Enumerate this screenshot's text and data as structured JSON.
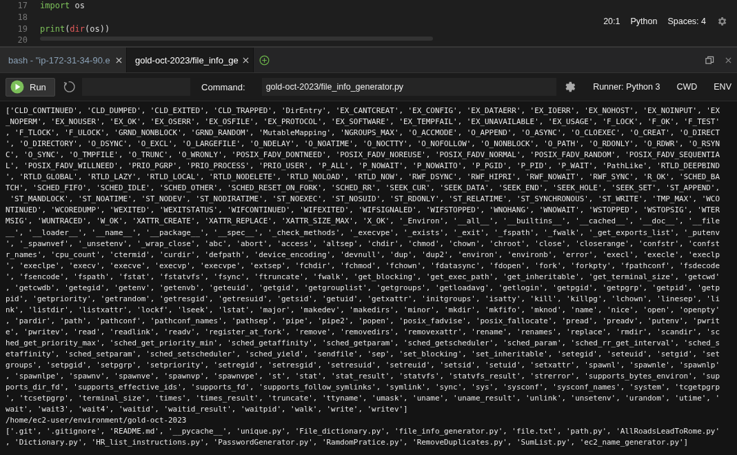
{
  "editor": {
    "lines": [
      {
        "number": "17",
        "tokens": [
          {
            "kind": "keyword",
            "text": "import"
          },
          {
            "kind": "plain",
            "text": " os"
          }
        ]
      },
      {
        "number": "18"
      },
      {
        "number": "19",
        "tokens": [
          {
            "kind": "function",
            "text": "print"
          },
          {
            "kind": "plain",
            "text": "("
          },
          {
            "kind": "builtin",
            "text": "dir"
          },
          {
            "kind": "plain",
            "text": "(os))"
          }
        ]
      },
      {
        "number": "20"
      }
    ],
    "status": {
      "position": "20:1",
      "language": "Python",
      "indent": "Spaces: 4"
    }
  },
  "tabs": [
    {
      "label": "bash - \"ip-172-31-34-90.e",
      "selected": false
    },
    {
      "label": "gold-oct-2023/file_info_ge",
      "selected": true
    }
  ],
  "toolbar": {
    "run": "Run",
    "command_label": "Command:",
    "command": "gold-oct-2023/file_info_generator.py",
    "runner": "Runner: Python 3",
    "cwd": "CWD",
    "env": "ENV"
  },
  "output": [
    "['CLD_CONTINUED', 'CLD_DUMPED', 'CLD_EXITED', 'CLD_TRAPPED', 'DirEntry', 'EX_CANTCREAT', 'EX_CONFIG', 'EX_DATAERR', 'EX_IOERR', 'EX_NOHOST', 'EX_NOINPUT', 'EX",
    "_NOPERM', 'EX_NOUSER', 'EX_OK', 'EX_OSERR', 'EX_OSFILE', 'EX_PROTOCOL', 'EX_SOFTWARE', 'EX_TEMPFAIL', 'EX_UNAVAILABLE', 'EX_USAGE', 'F_LOCK', 'F_OK', 'F_TEST'",
    ", 'F_TLOCK', 'F_ULOCK', 'GRND_NONBLOCK', 'GRND_RANDOM', 'MutableMapping', 'NGROUPS_MAX', 'O_ACCMODE', 'O_APPEND', 'O_ASYNC', 'O_CLOEXEC', 'O_CREAT', 'O_DIRECT",
    "', 'O_DIRECTORY', 'O_DSYNC', 'O_EXCL', 'O_LARGEFILE', 'O_NDELAY', 'O_NOATIME', 'O_NOCTTY', 'O_NOFOLLOW', 'O_NONBLOCK', 'O_PATH', 'O_RDONLY', 'O_RDWR', 'O_RSYN",
    "C', 'O_SYNC', 'O_TMPFILE', 'O_TRUNC', 'O_WRONLY', 'POSIX_FADV_DONTNEED', 'POSIX_FADV_NOREUSE', 'POSIX_FADV_NORMAL', 'POSIX_FADV_RANDOM', 'POSIX_FADV_SEQUENTIA",
    "L', 'POSIX_FADV_WILLNEED', 'PRIO_PGRP', 'PRIO_PROCESS', 'PRIO_USER', 'P_ALL', 'P_NOWAIT', 'P_NOWAITO', 'P_PGID', 'P_PID', 'P_WAIT', 'PathLike', 'RTLD_DEEPBIND",
    "', 'RTLD_GLOBAL', 'RTLD_LAZY', 'RTLD_LOCAL', 'RTLD_NODELETE', 'RTLD_NOLOAD', 'RTLD_NOW', 'RWF_DSYNC', 'RWF_HIPRI', 'RWF_NOWAIT', 'RWF_SYNC', 'R_OK', 'SCHED_BA",
    "TCH', 'SCHED_FIFO', 'SCHED_IDLE', 'SCHED_OTHER', 'SCHED_RESET_ON_FORK', 'SCHED_RR', 'SEEK_CUR', 'SEEK_DATA', 'SEEK_END', 'SEEK_HOLE', 'SEEK_SET', 'ST_APPEND',",
    " 'ST_MANDLOCK', 'ST_NOATIME', 'ST_NODEV', 'ST_NODIRATIME', 'ST_NOEXEC', 'ST_NOSUID', 'ST_RDONLY', 'ST_RELATIME', 'ST_SYNCHRONOUS', 'ST_WRITE', 'TMP_MAX', 'WCO",
    "NTINUED', 'WCOREDUMP', 'WEXITED', 'WEXITSTATUS', 'WIFCONTINUED', 'WIFEXITED', 'WIFSIGNALED', 'WIFSTOPPED', 'WNOHANG', 'WNOWAIT', 'WSTOPPED', 'WSTOPSIG', 'WTER",
    "MSIG', 'WUNTRACED', 'W_OK', 'XATTR_CREATE', 'XATTR_REPLACE', 'XATTR_SIZE_MAX', 'X_OK', '_Environ', '__all__', '__builtins__', '__cached__', '__doc__', '__file",
    "__', '__loader__', '__name__', '__package__', '__spec__', '_check_methods', '_execvpe', '_exists', '_exit', '_fspath', '_fwalk', '_get_exports_list', '_putenv",
    "', '_spawnvef', '_unsetenv', '_wrap_close', 'abc', 'abort', 'access', 'altsep', 'chdir', 'chmod', 'chown', 'chroot', 'close', 'closerange', 'confstr', 'confst",
    "r_names', 'cpu_count', 'ctermid', 'curdir', 'defpath', 'device_encoding', 'devnull', 'dup', 'dup2', 'environ', 'environb', 'error', 'execl', 'execle', 'execlp",
    "', 'execlpe', 'execv', 'execve', 'execvp', 'execvpe', 'extsep', 'fchdir', 'fchmod', 'fchown', 'fdatasync', 'fdopen', 'fork', 'forkpty', 'fpathconf', 'fsdecode",
    "', 'fsencode', 'fspath', 'fstat', 'fstatvfs', 'fsync', 'ftruncate', 'fwalk', 'get_blocking', 'get_exec_path', 'get_inheritable', 'get_terminal_size', 'getcwd'",
    ", 'getcwdb', 'getegid', 'getenv', 'getenvb', 'geteuid', 'getgid', 'getgrouplist', 'getgroups', 'getloadavg', 'getlogin', 'getpgid', 'getpgrp', 'getpid', 'getp",
    "pid', 'getpriority', 'getrandom', 'getresgid', 'getresuid', 'getsid', 'getuid', 'getxattr', 'initgroups', 'isatty', 'kill', 'killpg', 'lchown', 'linesep', 'li",
    "nk', 'listdir', 'listxattr', 'lockf', 'lseek', 'lstat', 'major', 'makedev', 'makedirs', 'minor', 'mkdir', 'mkfifo', 'mknod', 'name', 'nice', 'open', 'openpty'",
    ", 'pardir', 'path', 'pathconf', 'pathconf_names', 'pathsep', 'pipe', 'pipe2', 'popen', 'posix_fadvise', 'posix_fallocate', 'pread', 'preadv', 'putenv', 'pwrit",
    "e', 'pwritev', 'read', 'readlink', 'readv', 'register_at_fork', 'remove', 'removedirs', 'removexattr', 'rename', 'renames', 'replace', 'rmdir', 'scandir', 'sc",
    "hed_get_priority_max', 'sched_get_priority_min', 'sched_getaffinity', 'sched_getparam', 'sched_getscheduler', 'sched_param', 'sched_rr_get_interval', 'sched_s",
    "etaffinity', 'sched_setparam', 'sched_setscheduler', 'sched_yield', 'sendfile', 'sep', 'set_blocking', 'set_inheritable', 'setegid', 'seteuid', 'setgid', 'set",
    "groups', 'setpgid', 'setpgrp', 'setpriority', 'setregid', 'setresgid', 'setresuid', 'setreuid', 'setsid', 'setuid', 'setxattr', 'spawnl', 'spawnle', 'spawnlp'",
    ", 'spawnlpe', 'spawnv', 'spawnve', 'spawnvp', 'spawnvpe', 'st', 'stat', 'stat_result', 'statvfs', 'statvfs_result', 'strerror', 'supports_bytes_environ', 'sup",
    "ports_dir_fd', 'supports_effective_ids', 'supports_fd', 'supports_follow_symlinks', 'symlink', 'sync', 'sys', 'sysconf', 'sysconf_names', 'system', 'tcgetpgrp",
    "', 'tcsetpgrp', 'terminal_size', 'times', 'times_result', 'truncate', 'ttyname', 'umask', 'uname', 'uname_result', 'unlink', 'unsetenv', 'urandom', 'utime', '",
    "wait', 'wait3', 'wait4', 'waitid', 'waitid_result', 'waitpid', 'walk', 'write', 'writev']",
    "/home/ec2-user/environment/gold-oct-2023",
    "['.git', '.gitignore', 'README.md', '__pycache__', 'unique.py', 'File_dictionary.py', 'file_info_generator.py', 'file.txt', 'path.py', 'AllRoadsLeadToRome.py'",
    ", 'Dictionary.py', 'HR_list_instructions.py', 'PasswordGenerator.py', 'RamdomPratice.py', 'RemoveDuplicates.py', 'SumList.py', 'ec2_name_generator.py']"
  ]
}
